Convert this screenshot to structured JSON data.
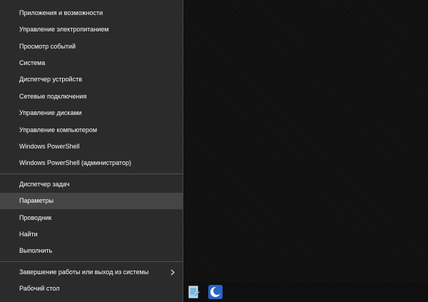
{
  "context_menu": {
    "group1": [
      "Приложения и возможности",
      "Управление электропитанием",
      "Просмотр событий",
      "Система",
      "Диспетчер устройств",
      "Сетевые подключения",
      "Управление дисками",
      "Управление компьютером",
      "Windows PowerShell",
      "Windows PowerShell (администратор)"
    ],
    "group2": [
      "Диспетчер задач",
      "Параметры",
      "Проводник",
      "Найти",
      "Выполнить"
    ],
    "group3": [
      "Завершение работы или выход из системы",
      "Рабочий стол"
    ],
    "highlighted_item": "Параметры"
  },
  "taskbar": {
    "icons": [
      "notepad-icon",
      "app-crescent-icon"
    ]
  },
  "colors": {
    "menu_background": "#2b2b2b",
    "hover_background": "#454545",
    "text": "#ffffff",
    "separator": "#505050",
    "desktop_background": "#121212"
  }
}
